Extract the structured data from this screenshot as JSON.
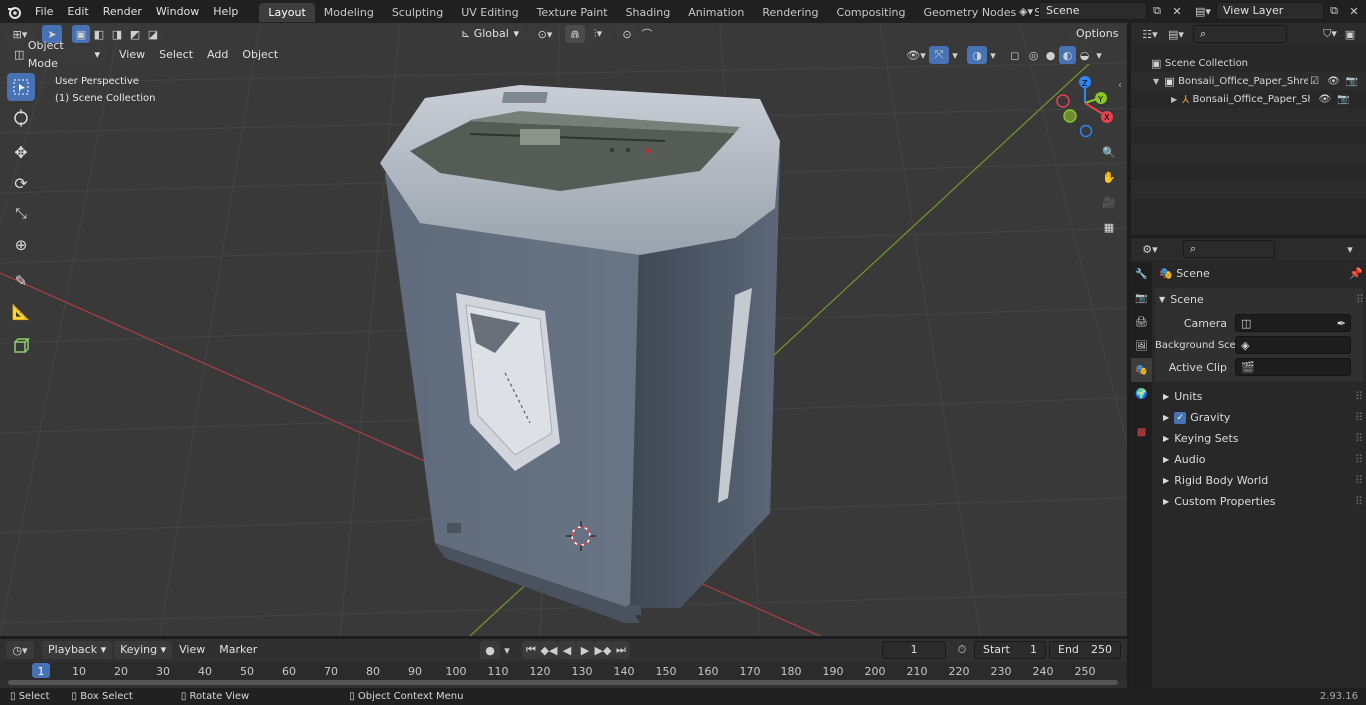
{
  "topbar": {
    "menus": [
      "File",
      "Edit",
      "Render",
      "Window",
      "Help"
    ],
    "workspaces": [
      "Layout",
      "Modeling",
      "Sculpting",
      "UV Editing",
      "Texture Paint",
      "Shading",
      "Animation",
      "Rendering",
      "Compositing",
      "Geometry Nodes",
      "Scripting"
    ],
    "active_workspace": "Layout",
    "add_tab": "+",
    "scene_name": "Scene",
    "view_layer": "View Layer"
  },
  "viewport": {
    "transform_orientation": "Global",
    "options_label": "Options",
    "mode": "Object Mode",
    "header_menus": [
      "View",
      "Select",
      "Add",
      "Object"
    ],
    "overlay_line1": "User Perspective",
    "overlay_line2": "(1) Scene Collection",
    "gizmo_axes": {
      "x": "X",
      "y": "Y",
      "z": "Z"
    }
  },
  "outliner": {
    "root": "Scene Collection",
    "items": [
      {
        "name": "Bonsaii_Office_Paper_Shredd"
      },
      {
        "name": "Bonsaii_Office_Paper_Sh"
      }
    ]
  },
  "properties": {
    "context": "Scene",
    "panel_title": "Scene",
    "fields": [
      {
        "label": "Camera"
      },
      {
        "label": "Background Scene"
      },
      {
        "label": "Active Clip"
      }
    ],
    "subpanels": [
      "Units",
      "Gravity",
      "Keying Sets",
      "Audio",
      "Rigid Body World",
      "Custom Properties"
    ],
    "gravity_checked": true
  },
  "timeline": {
    "menus": [
      "Playback",
      "Keying",
      "View",
      "Marker"
    ],
    "current_frame": "1",
    "start_label": "Start",
    "start_value": "1",
    "end_label": "End",
    "end_value": "250",
    "ticks": [
      "1",
      "10",
      "20",
      "30",
      "40",
      "50",
      "60",
      "70",
      "80",
      "90",
      "100",
      "110",
      "120",
      "130",
      "140",
      "150",
      "160",
      "170",
      "180",
      "190",
      "200",
      "210",
      "220",
      "230",
      "240",
      "250"
    ]
  },
  "statusbar": {
    "select": "Select",
    "box_select": "Box Select",
    "rotate_view": "Rotate View",
    "context_menu": "Object Context Menu",
    "version": "2.93.16"
  },
  "colors": {
    "accent": "#4772b3",
    "viewport_bg": "#393939",
    "axis_x": "#e8424f",
    "axis_y": "#88c624",
    "axis_z": "#2f85f5"
  }
}
